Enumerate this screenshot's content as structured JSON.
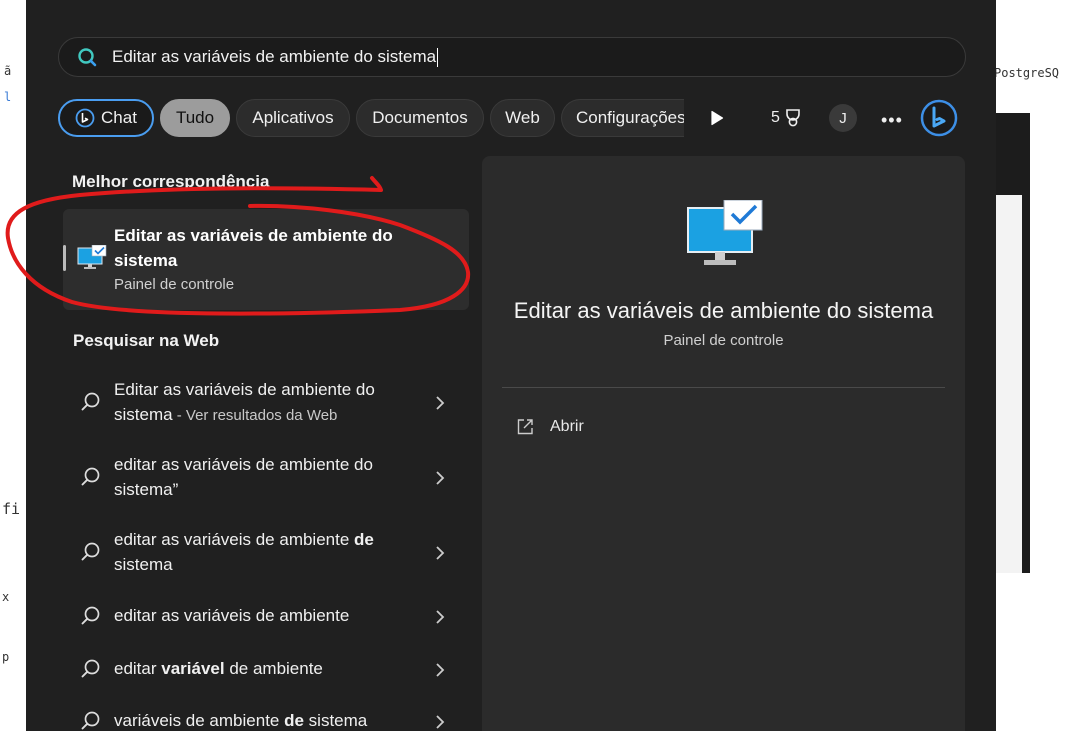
{
  "background": {
    "right_fragment": "PostgreSQ",
    "left_fragments": [
      "ã",
      "l",
      "fi",
      "x",
      "p"
    ]
  },
  "search": {
    "query": "Editar as variáveis de ambiente do sistema"
  },
  "filters": {
    "chat": "Chat",
    "tudo": "Tudo",
    "aplicativos": "Aplicativos",
    "documentos": "Documentos",
    "web": "Web",
    "configuracoes": "Configurações",
    "rewards_count": "5",
    "avatar_initial": "J",
    "more": "•••"
  },
  "best_match": {
    "section_title": "Melhor correspondência",
    "title": "Editar as variáveis de ambiente do sistema",
    "subtitle": "Painel de controle"
  },
  "web_search": {
    "section_title": "Pesquisar na Web",
    "items": [
      {
        "pre": "Editar as variáveis de ambiente do sistema",
        "bold": "",
        "post": "",
        "suffix": " - Ver resultados da Web"
      },
      {
        "pre": "editar as variáveis de ambiente do sistema”",
        "bold": "",
        "post": "",
        "suffix": ""
      },
      {
        "pre": "editar as variáveis de ambiente ",
        "bold": "de",
        "post": " sistema",
        "suffix": ""
      },
      {
        "pre": "editar as variáveis de ambiente",
        "bold": "",
        "post": "",
        "suffix": ""
      },
      {
        "pre": "editar ",
        "bold": "variável",
        "post": " de ambiente",
        "suffix": ""
      },
      {
        "pre": "variáveis de ambiente ",
        "bold": "de",
        "post": " sistema",
        "suffix": ""
      }
    ]
  },
  "detail": {
    "title": "Editar as variáveis de ambiente do sistema",
    "subtitle": "Painel de controle",
    "open_label": "Abrir"
  },
  "colors": {
    "panel": "#202020",
    "detail": "#2b2b2b",
    "accent_blue": "#4a9df0",
    "annotation_red": "#e01b1b"
  }
}
